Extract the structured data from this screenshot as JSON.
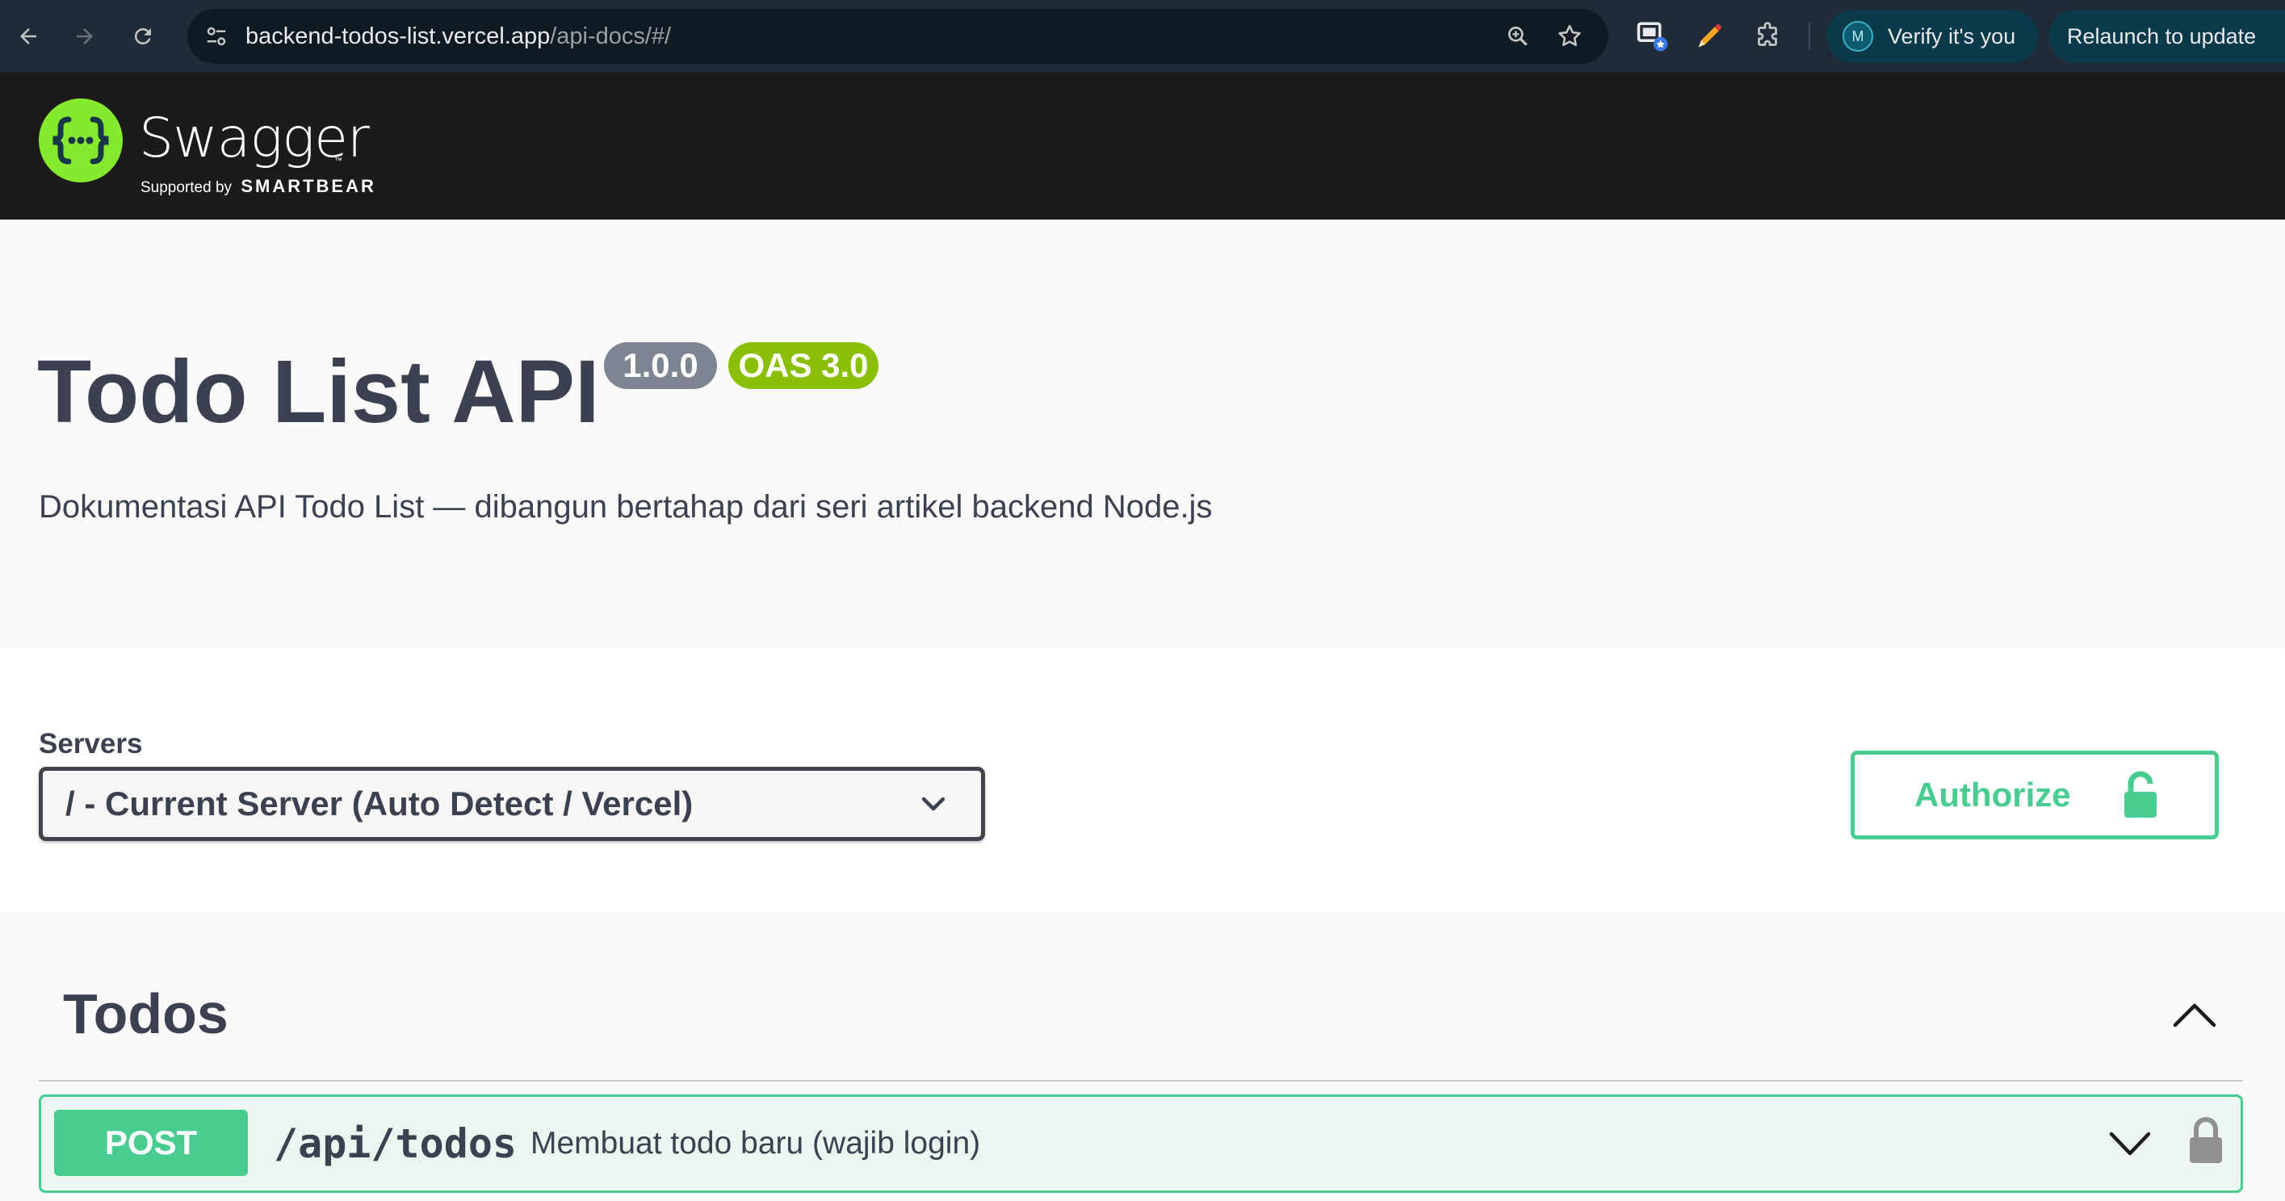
{
  "browser": {
    "url_host": "backend-todos-list.vercel.app",
    "url_path": "/api-docs/#/",
    "verify_label": "Verify it's you",
    "avatar_initial": "M",
    "relaunch_label": "Relaunch to update"
  },
  "topbar": {
    "logo_title": "Swagger",
    "logo_supported_by": "Supported by",
    "logo_brand": "SMARTBEAR",
    "logo_brand_color": "#85ea2d"
  },
  "info": {
    "title": "Todo List API",
    "version": "1.0.0",
    "oas_version": "OAS 3.0",
    "description": "Dokumentasi API Todo List — dibangun bertahap dari seri artikel backend Node.js"
  },
  "servers": {
    "label": "Servers",
    "selected": "/ - Current Server (Auto Detect / Vercel)"
  },
  "authorize": {
    "label": "Authorize",
    "color": "#49cc90"
  },
  "tags": [
    {
      "name": "Todos",
      "operations": [
        {
          "method": "POST",
          "path": "/api/todos",
          "summary": "Membuat todo baru (wajib login)",
          "color": "#49cc90"
        }
      ]
    }
  ],
  "icons": {
    "back": "arrow-left-icon",
    "forward": "arrow-right-icon",
    "reload": "reload-icon",
    "site_info": "tune-icon",
    "zoom": "zoom-icon",
    "bookmark": "star-icon",
    "extension_cast": "cast-icon",
    "extension_pen": "pencil-icon",
    "extensions": "puzzle-icon",
    "lock": "lock-icon",
    "chevron_down": "chevron-down-icon",
    "chevron_up": "chevron-up-icon"
  }
}
